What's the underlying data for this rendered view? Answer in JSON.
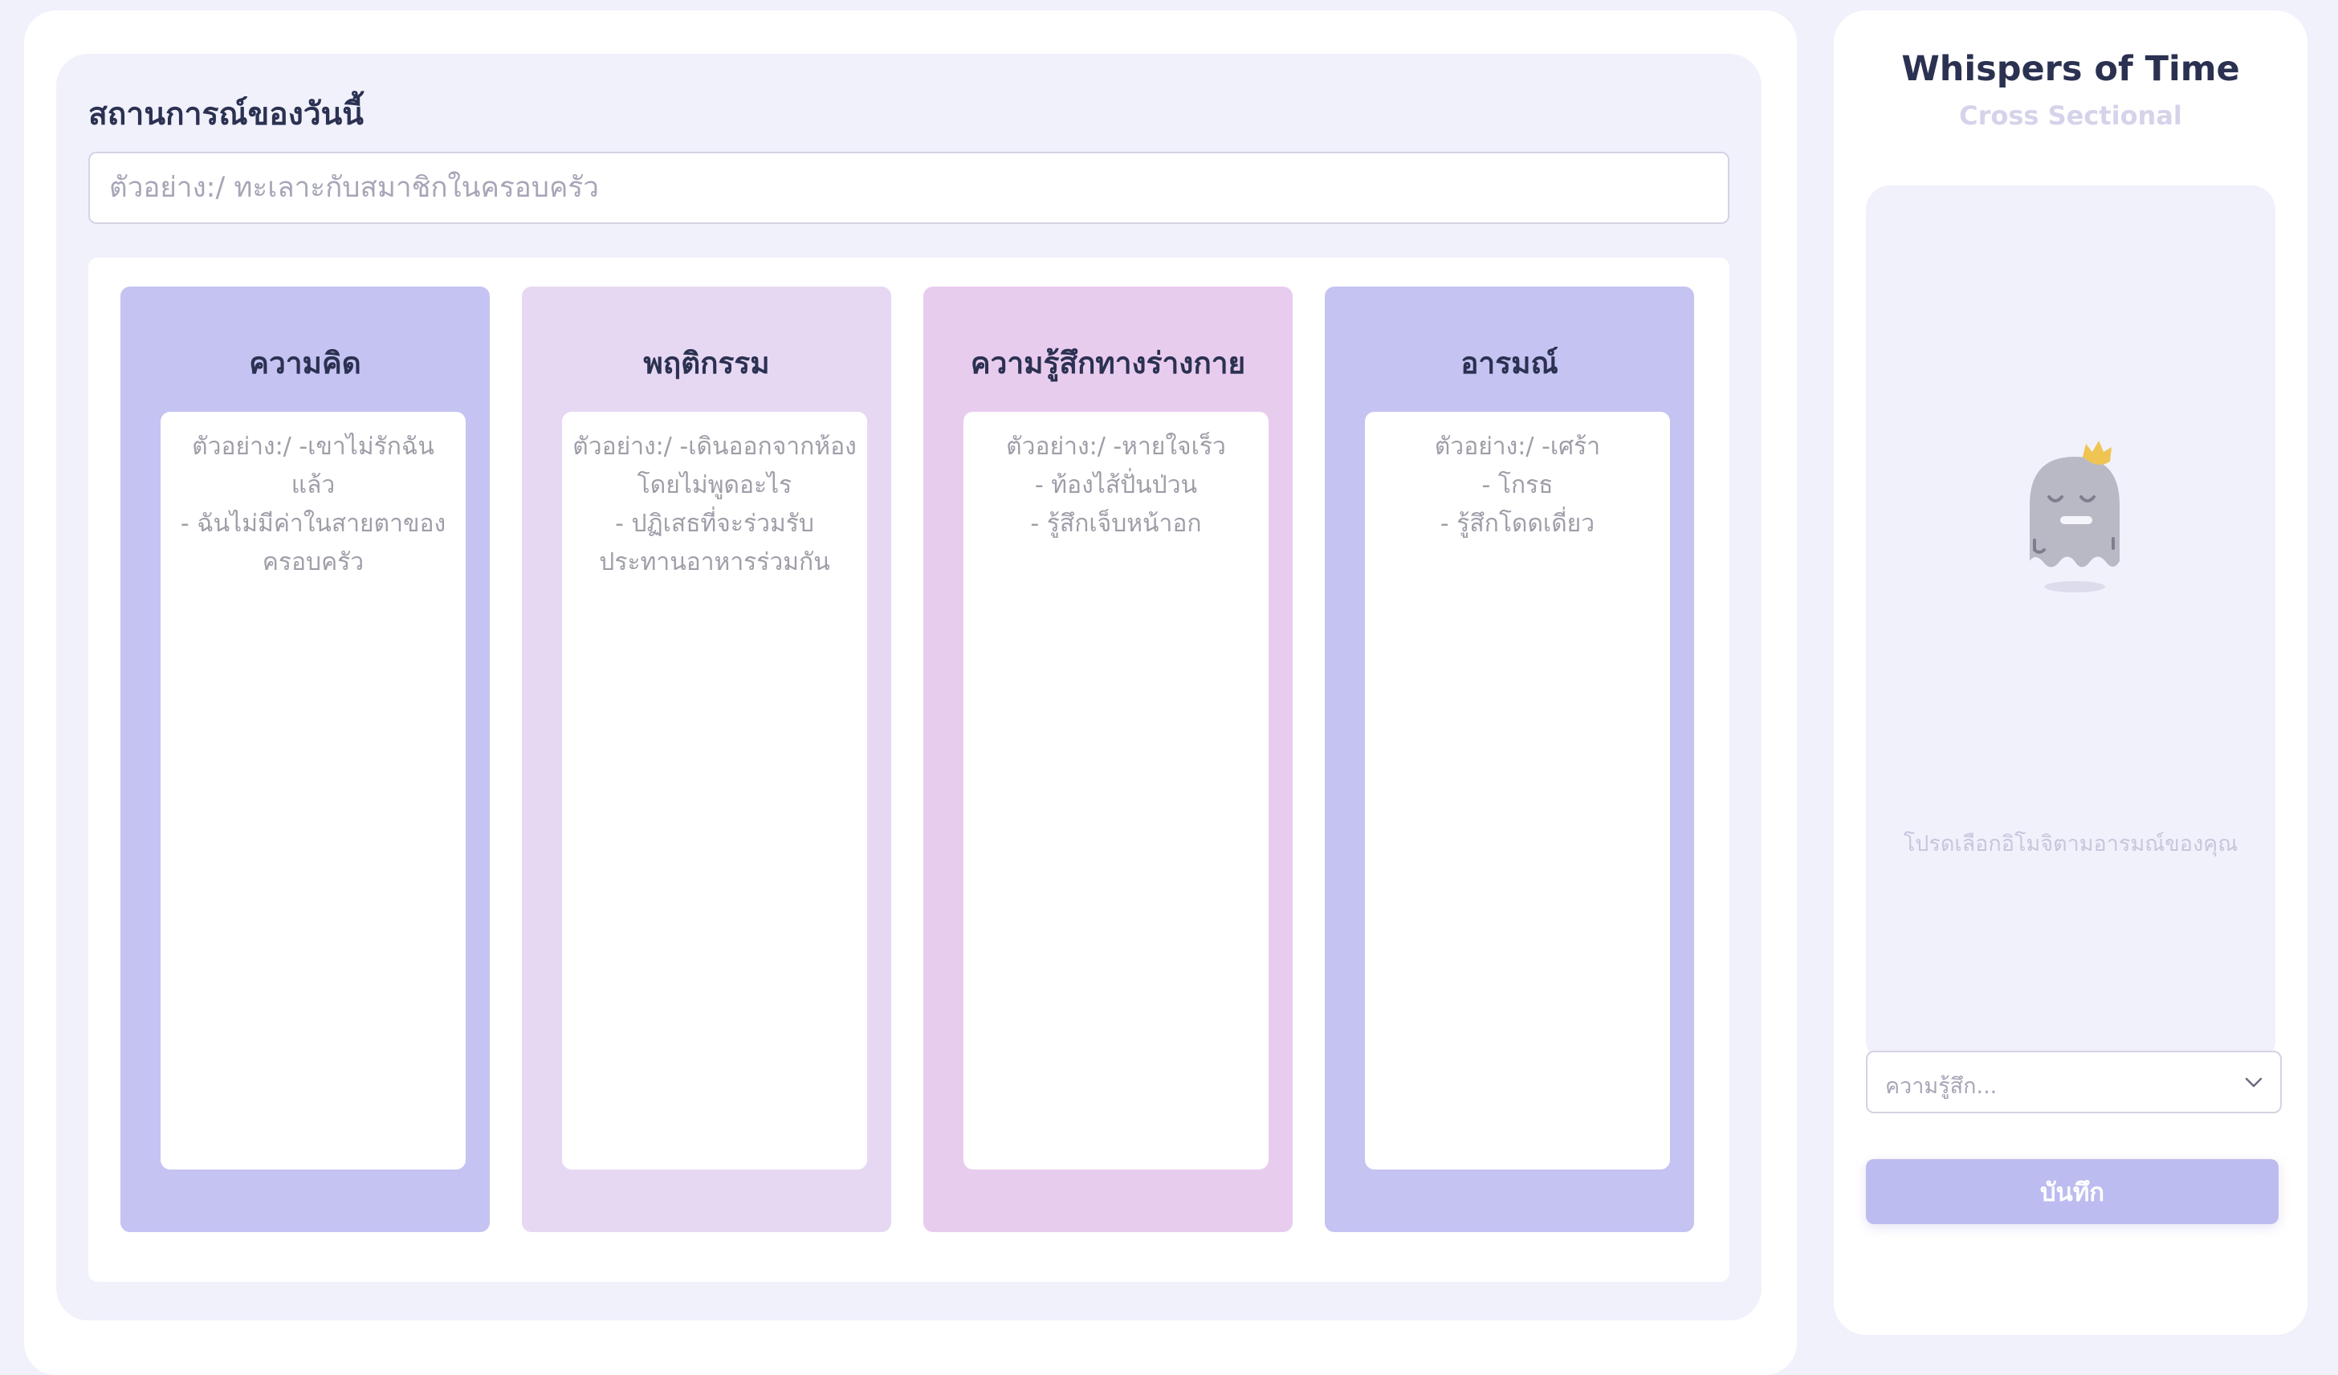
{
  "situation": {
    "title": "สถานการณ์ของวันนี้",
    "placeholder": "ตัวอย่าง:/ ทะเลาะกับสมาชิกในครอบครัว"
  },
  "columns": [
    {
      "title": "ความคิด",
      "placeholder": "ตัวอย่าง:/ -เขาไม่รักฉันแล้ว\n- ฉันไม่มีค่าในสายตาของครอบครัว",
      "color": "#c4c3f2"
    },
    {
      "title": "พฤติกรรม",
      "placeholder": "ตัวอย่าง:/ -เดินออกจากห้องโดยไม่พูดอะไร\n- ปฏิเสธที่จะร่วมรับประทานอาหารร่วมกัน",
      "color": "#e6d8f3"
    },
    {
      "title": "ความรู้สึกทางร่างกาย",
      "placeholder": "ตัวอย่าง:/ -หายใจเร็ว\n- ท้องไส้ปั่นป่วน\n- รู้สึกเจ็บหน้าอก",
      "color": "#e8ccee"
    },
    {
      "title": "อารมณ์",
      "placeholder": "ตัวอย่าง:/ -เศร้า\n- โกรธ\n- รู้สึกโดดเดี่ยว",
      "color": "#c4c3f2"
    }
  ],
  "sidebar": {
    "app_title": "Whispers of Time",
    "subtitle": "Cross Sectional",
    "emoji_hint": "โปรดเลือกอิโมจิตามอารมณ์ของคุณ",
    "emoji_icon": "sleeping-ghost-icon",
    "feeling_select": {
      "value": "ความรู้สึก..."
    },
    "save_label": "บันทึก"
  },
  "colors": {
    "background": "#f1f1fc",
    "accent": "#bdbcf0",
    "text": "#2b3151"
  }
}
